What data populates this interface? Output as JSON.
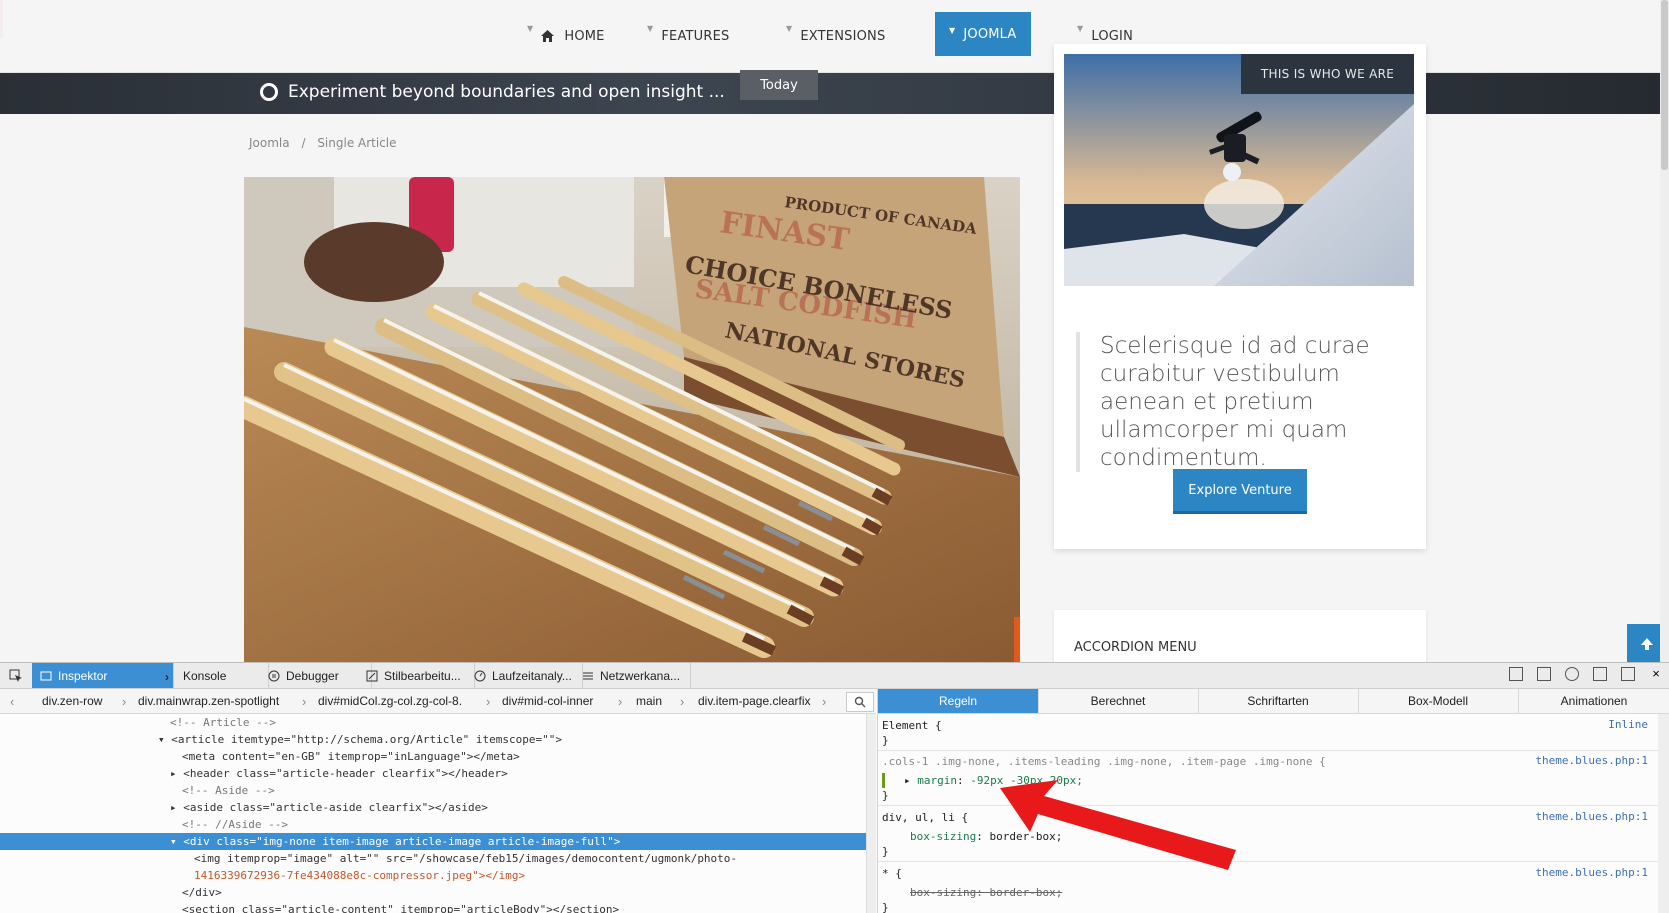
{
  "nav": {
    "items": [
      {
        "label": "HOME"
      },
      {
        "label": "FEATURES"
      },
      {
        "label": "EXTENSIONS"
      },
      {
        "label": "JOOMLA"
      },
      {
        "label": "LOGIN"
      }
    ]
  },
  "ticker": {
    "text": "Experiment beyond boundaries and open insight ...",
    "button": "Today"
  },
  "breadcrumb": {
    "items": [
      "Joomla",
      "/",
      "Single Article"
    ]
  },
  "sidebar": {
    "banner": "THIS IS WHO WE ARE",
    "quote": "Scelerisque id ad curae curabitur vestibulum aenean et pretium ullamcorper mi quam condimentum.",
    "button": "Explore Venture"
  },
  "accordion": {
    "title": "ACCORDION MENU"
  },
  "devtools": {
    "tabs": [
      "Inspektor",
      "Konsole",
      "Debugger",
      "Stilbearbeitu...",
      "Laufzeitanaly...",
      "Netzwerkana..."
    ],
    "breadcrumb": [
      "div.zen-row",
      "div.mainwrap.zen-spotlight",
      "div#midCol.zg-col.zg-col-8.",
      "div#mid-col-inner",
      "main",
      "div.item-page.clearfix"
    ],
    "rules_tabs": [
      "Regeln",
      "Berechnet",
      "Schriftarten",
      "Box-Modell",
      "Animationen"
    ],
    "markup": [
      "<!-- Article -->",
      "<article itemtype=\"http://schema.org/Article\" itemscope=\"\">",
      "<meta content=\"en-GB\" itemprop=\"inLanguage\"></meta>",
      "<header class=\"article-header clearfix\"></header>",
      "<!-- Aside -->",
      "<aside class=\"article-aside clearfix\"></aside>",
      "<!-- //Aside -->",
      "<div class=\"img-none item-image article-image article-image-full\">",
      "<img itemprop=\"image\" alt=\"\" src=\"/showcase/feb15/images/democontent/ugmonk/photo-",
      "1416339672936-7fe434088e8c-compressor.jpeg\"></img>",
      "</div>",
      "<section class=\"article-content\" itemprop=\"articleBody\"></section>"
    ],
    "rules": {
      "element_selector": "Element {",
      "element_close": "}",
      "element_src": "Inline",
      "rule1_selector": ".cols-1 .img-none, .items-leading .img-none, .item-page .img-none {",
      "rule1_prop": "margin",
      "rule1_value": "-92px -30px 20px;",
      "rule1_src": "theme.blues.php:1",
      "rule2_selector": "div, ul, li {",
      "rule2_prop": "box-sizing",
      "rule2_value": "border-box;",
      "rule2_src": "theme.blues.php:1",
      "rule3_selector": "* {",
      "rule3_prop": "box-sizing: border-box;",
      "rule3_src": "theme.blues.php:1",
      "close": "}"
    }
  },
  "colors": {
    "accent": "#2d86c4",
    "devtools_select": "#3d8fd4",
    "annotation_arrow": "#e8191a"
  }
}
